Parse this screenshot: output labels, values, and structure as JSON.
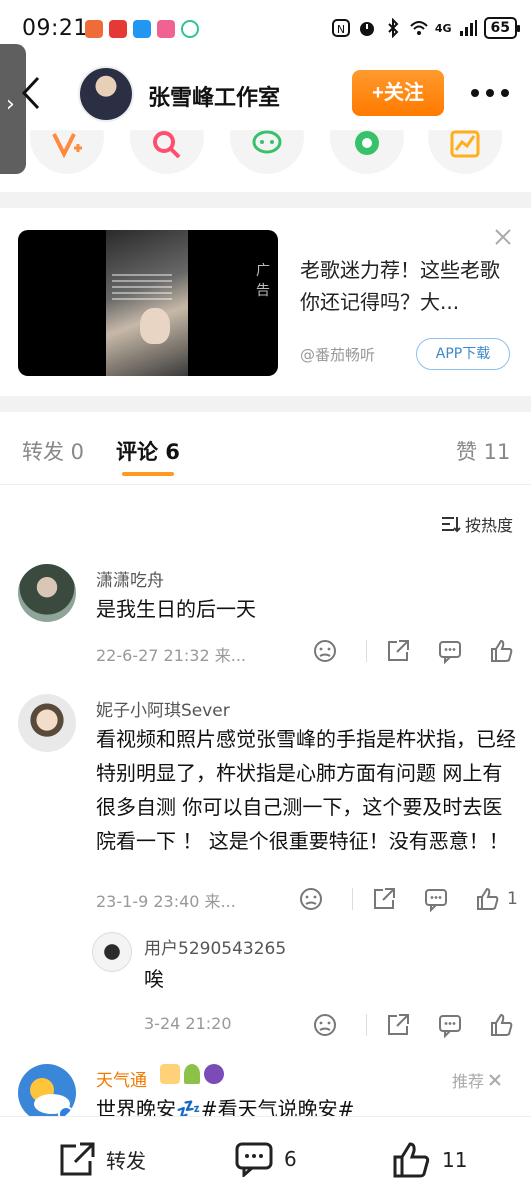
{
  "status_bar": {
    "time": "09:21",
    "network": "4G",
    "battery": "65"
  },
  "header": {
    "title": "张雪峰工作室",
    "follow_label": "+关注"
  },
  "ad": {
    "label": "广告",
    "headline": "老歌迷力荐！这些老歌你还记得吗？大...",
    "source": "@番茄畅听",
    "app_button": "APP下载"
  },
  "tabs": {
    "repost": "转发 0",
    "comments": "评论 6",
    "likes": "赞 11"
  },
  "sort": {
    "label": "按热度"
  },
  "comments": [
    {
      "name": "潇潇吃舟",
      "text": "是我生日的后一天",
      "meta": "22-6-27 21:32  来..."
    },
    {
      "name": "妮子小阿琪Sever",
      "text": "看视频和照片感觉张雪峰的手指是杵状指，已经特别明显了，杵状指是心肺方面有问题 网上有很多自测 你可以自己测一下，这个要及时去医院看一下 ！ 这是个很重要特征！没有恶意！！",
      "meta": "23-1-9 23:40  来...",
      "like_count": "1",
      "reply": {
        "name": "用户5290543265",
        "text": "唉",
        "meta": "3-24 21:20"
      }
    },
    {
      "name": "天气通",
      "text": "世界晚安💤#看天气说晚安#",
      "recommend": "推荐"
    }
  ],
  "bottom_bar": {
    "repost": "转发",
    "comments": "6",
    "likes": "11"
  },
  "colors": {
    "accent": "#ff8a00",
    "weibo_orange": "#ff9a1e",
    "link_blue": "#3e88c8"
  }
}
